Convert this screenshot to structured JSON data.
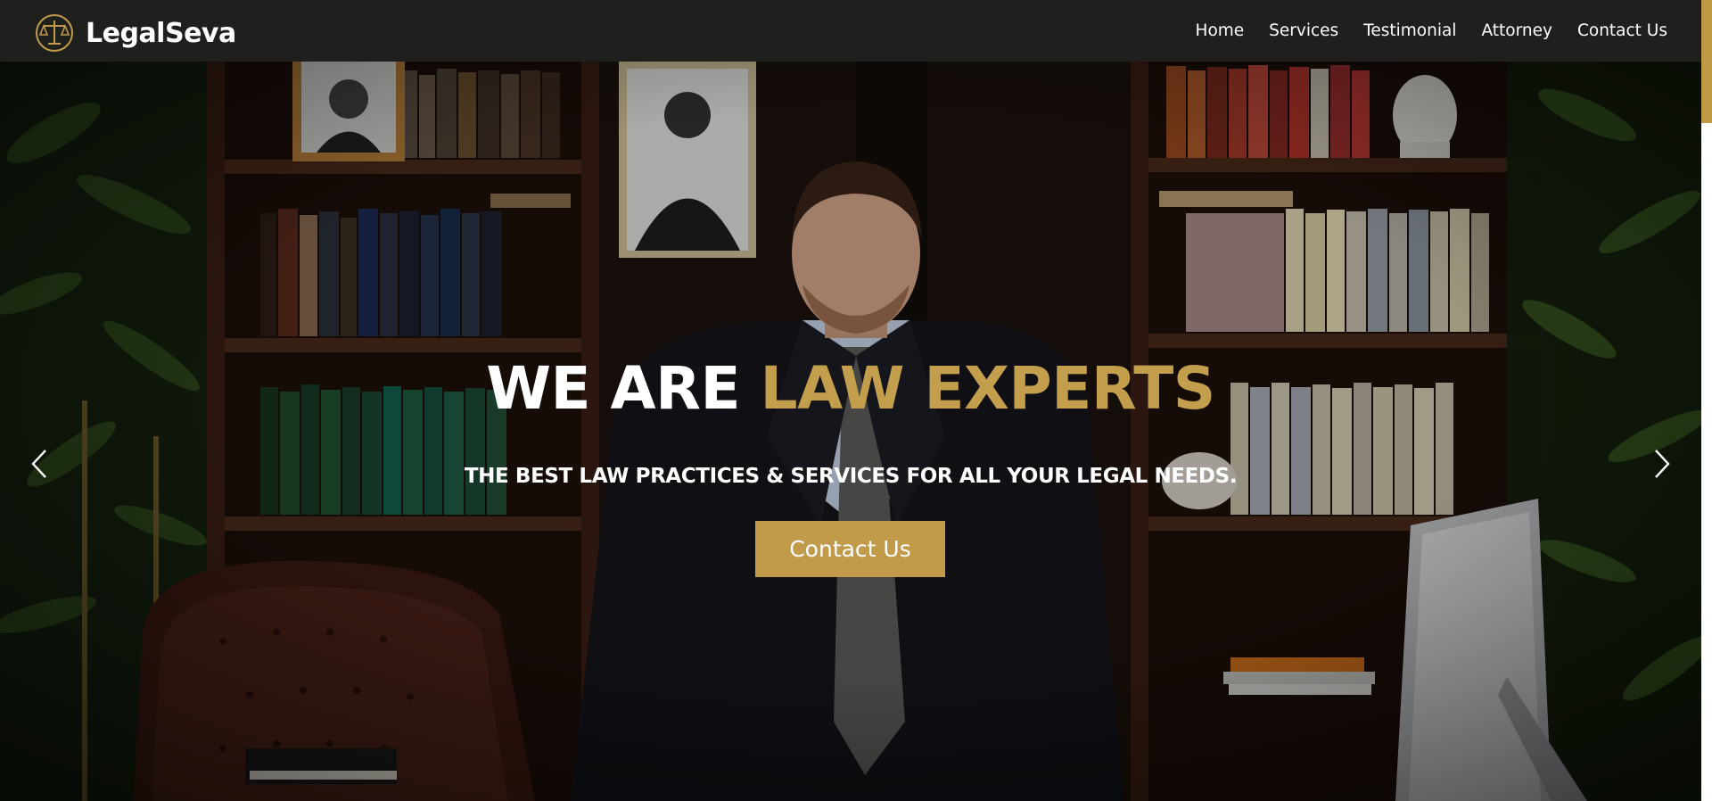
{
  "brand": {
    "name": "LegalSeva",
    "logo_icon": "scales-of-justice-icon"
  },
  "nav": {
    "items": [
      {
        "label": "Home"
      },
      {
        "label": "Services"
      },
      {
        "label": "Testimonial"
      },
      {
        "label": "Attorney"
      },
      {
        "label": "Contact Us"
      }
    ]
  },
  "hero": {
    "title_white": "WE ARE ",
    "title_gold": "LAW EXPERTS",
    "subtitle": "THE BEST LAW PRACTICES & SERVICES FOR ALL YOUR LEGAL NEEDS.",
    "cta_label": "Contact Us",
    "prev_icon": "chevron-left-icon",
    "next_icon": "chevron-right-icon"
  },
  "colors": {
    "navbar_bg": "#1f1f1d",
    "accent_gold": "#c19a4a",
    "text_white": "#ffffff"
  }
}
